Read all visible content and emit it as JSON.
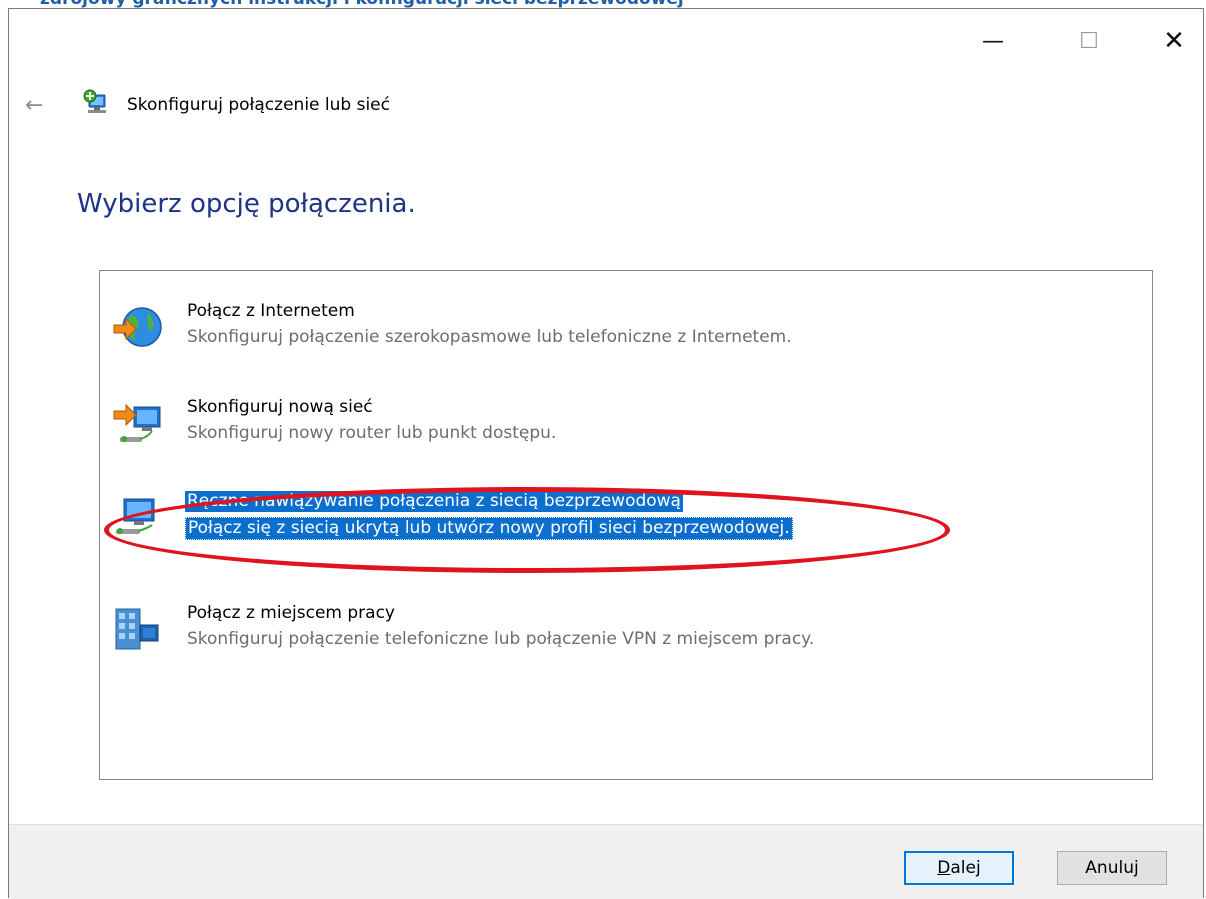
{
  "background_strip": {
    "text": "zdrojowy graficznych instrukcji i konfiguracji sieci bezprzewodowej"
  },
  "window": {
    "title": "Skonfiguruj połączenie lub sieć",
    "caption_buttons": {
      "minimize": "—",
      "maximize": "☐",
      "close": "✕"
    }
  },
  "wizard": {
    "back_icon": "←",
    "heading": "Wybierz opcję połączenia."
  },
  "options": [
    {
      "icon": "globe-connect-icon",
      "title": "Połącz z Internetem",
      "description": "Skonfiguruj połączenie szerokopasmowe lub telefoniczne z Internetem.",
      "selected": false
    },
    {
      "icon": "new-network-icon",
      "title": "Skonfiguruj nową sieć",
      "description": "Skonfiguruj nowy router lub punkt dostępu.",
      "selected": false
    },
    {
      "icon": "wireless-network-icon",
      "title": "Ręczne nawiązywanie połączenia z siecią bezprzewodową",
      "description": "Połącz się z siecią ukrytą lub utwórz nowy profil sieci bezprzewodowej.",
      "selected": true
    },
    {
      "icon": "workplace-vpn-icon",
      "title": "Połącz z miejscem pracy",
      "description": "Skonfiguruj połączenie telefoniczne lub połączenie VPN z miejscem pracy.",
      "selected": false
    }
  ],
  "footer": {
    "next_mnemonic": "D",
    "next_rest": "alej",
    "cancel": "Anuluj"
  },
  "colors": {
    "heading": "#1e3287",
    "selection": "#0c6fce",
    "annotation": "#e0141e"
  }
}
